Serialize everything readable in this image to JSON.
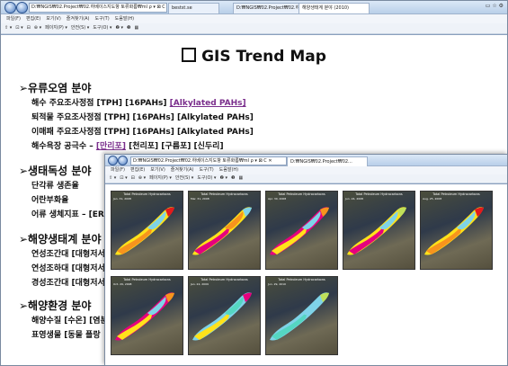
{
  "main_window": {
    "address": "D:₩NGIS₩02.Project₩02.하베이스지도항 토류화름₩ml ρ ▾ ⊠ C ✕",
    "tabs": [
      {
        "label": "bestst.se",
        "active": false
      },
      {
        "label": "D:₩NGIS₩02.Project₩02.하베...",
        "active": false
      },
      {
        "label": "해양생태계 분야 (2010)",
        "active": true
      }
    ],
    "menu": [
      "파일(F)",
      "편집(E)",
      "보기(V)",
      "즐겨찾기(A)",
      "도구(T)",
      "도움말(H)"
    ],
    "commands": [
      "⇧ ▾",
      "⊡ ▾",
      "⊟",
      "⊕ ▾",
      "페이지(P) ▾",
      "안전(S) ▾",
      "도구(O) ▾",
      "❷ ▾",
      "❸",
      "▦"
    ],
    "window_controls": "▭ ☆ ⚙"
  },
  "page_title": "GIS Trend Map",
  "sections": [
    {
      "heading": "➢유류오염 분야",
      "rows": [
        [
          {
            "t": "해수 주요조사정점 ",
            "link": false
          },
          {
            "t": "[TPH]",
            "link": false
          },
          {
            "t": " [16PAHs] ",
            "link": false
          },
          {
            "t": "[Alkylated PAHs]",
            "link": true
          }
        ],
        [
          {
            "t": "퇴적물 주요조사정점 ",
            "link": false
          },
          {
            "t": "[TPH]",
            "link": false
          },
          {
            "t": " [16PAHs] ",
            "link": false
          },
          {
            "t": "[Alkylated PAHs]",
            "link": false
          }
        ],
        [
          {
            "t": "이매패 주요조사정점 ",
            "link": false
          },
          {
            "t": "[TPH]",
            "link": false
          },
          {
            "t": " [16PAHs] ",
            "link": false
          },
          {
            "t": "[Alkylated PAHs]",
            "link": false
          }
        ],
        [
          {
            "t": "해수욕장 공극수 – ",
            "link": false
          },
          {
            "t": "[만리포]",
            "link": true
          },
          {
            "t": " [천리포] ",
            "link": false
          },
          {
            "t": "[구름포]",
            "link": false
          },
          {
            "t": " [신두리]",
            "link": false
          }
        ]
      ]
    },
    {
      "heading": "➢생태독성 분야",
      "rows": [
        [
          {
            "t": "단각류 생존율",
            "link": false
          }
        ],
        [
          {
            "t": "어란부화율",
            "link": false
          }
        ],
        [
          {
            "t": "어류 생체지표 – [ERO",
            "link": false
          }
        ]
      ]
    },
    {
      "heading": "➢해양생태계 분야",
      "rows": [
        [
          {
            "t": "연성조간대 [대형저서",
            "link": false
          }
        ],
        [
          {
            "t": "연성조하대 [대형저서",
            "link": false
          }
        ],
        [
          {
            "t": "경성조간대 [대형저서",
            "link": false
          }
        ]
      ]
    },
    {
      "heading": "➢해양환경 분야",
      "rows": [
        [
          {
            "t": "해양수질 [수온] [염분",
            "link": false
          }
        ],
        [
          {
            "t": "표영생물 [동물 플랑",
            "link": false
          }
        ]
      ]
    }
  ],
  "popup_window": {
    "address": "D:₩NGIS₩02.Project₩02.하베이스지도항 토류화름₩ml ρ ▾ ⊠ C ✕",
    "tab": "D:₩NGIS₩02.Project₩02...",
    "menu": [
      "파일(F)",
      "편집(E)",
      "보기(V)",
      "즐겨찾기(A)",
      "도구(T)",
      "도움말(H)"
    ],
    "commands": [
      "⇧ ▾",
      "⊡ ▾",
      "⊟",
      "⊕ ▾",
      "페이지(P) ▾",
      "안전(S) ▾",
      "도구(O) ▾",
      "❷ ▾",
      "❸",
      "▦"
    ],
    "maps": [
      {
        "title": "Total Petroleum Hydrocarbons",
        "date": "Jan. 31, 2008",
        "palette": [
          "#ffe21a",
          "#f7941d",
          "#7fd3e8",
          "#e31a1c"
        ]
      },
      {
        "title": "Total Petroleum Hydrocarbons",
        "date": "Mar. 31, 2008",
        "palette": [
          "#ffe21a",
          "#e6007e",
          "#f7941d",
          "#7fd3e8"
        ]
      },
      {
        "title": "Total Petroleum Hydrocarbons",
        "date": "Apr. 30, 2008",
        "palette": [
          "#e6007e",
          "#ffe21a",
          "#7fd3e8",
          "#f7941d"
        ]
      },
      {
        "title": "Total Petroleum Hydrocarbons",
        "date": "Jun. 24, 2008",
        "palette": [
          "#ffe21a",
          "#e6007e",
          "#7fd3e8",
          "#c0e05a"
        ]
      },
      {
        "title": "Total Petroleum Hydrocarbons",
        "date": "Aug. 25, 2008",
        "palette": [
          "#ffe21a",
          "#f7941d",
          "#7fd3e8",
          "#e31a1c"
        ]
      },
      {
        "title": "Total Petroleum Hydrocarbons",
        "date": "Oct. 29, 2008",
        "palette": [
          "#e6007e",
          "#ffe21a",
          "#7fd3e8",
          "#f7941d"
        ]
      },
      {
        "title": "Total Petroleum Hydrocarbons",
        "date": "Jan. 22, 2009",
        "palette": [
          "#7fd3e8",
          "#ffe21a",
          "#55d6c2",
          "#e6007e"
        ]
      },
      {
        "title": "Total Petroleum Hydrocarbons",
        "date": "Jun. 29, 2010",
        "palette": [
          "#7fd3e8",
          "#55d6c2",
          "#7fd3e8",
          "#c0e05a"
        ]
      }
    ]
  }
}
